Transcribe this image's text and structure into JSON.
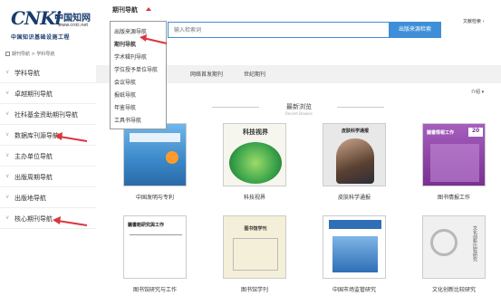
{
  "header": {
    "logo_cnki": "CNKi",
    "logo_cn_name": "中国知网",
    "logo_url": "www.cnki.net",
    "logo_project": "中国知识基础设施工程",
    "nav_title": "期刊导航",
    "search_placeholder": "输入检索词",
    "search_button": "出版来源检索",
    "help_link": "文献检索 ›"
  },
  "dropdown": {
    "items": [
      "出版来源导航",
      "期刊导航",
      "学术辑刊导航",
      "学位授予单位导航",
      "会议导航",
      "报纸导航",
      "年鉴导航",
      "工具书导航"
    ],
    "selected": "期刊导航"
  },
  "breadcrumb": {
    "home": "期刊导航",
    "sep": ">",
    "current": "学科导航"
  },
  "sidebar": {
    "items": [
      "学科导航",
      "卓越期刊导航",
      "社科基金资助期刊导航",
      "数据库刊源导航",
      "主办单位导航",
      "出版周期导航",
      "出版地导航",
      "核心期刊导航"
    ]
  },
  "tabs": [
    "网络首发期刊",
    "世纪期刊"
  ],
  "intro_button": "介绍 ▾",
  "recent": {
    "title": "最新浏览",
    "subtitle": "Recent Browse"
  },
  "journals": [
    {
      "title": "中国发明与专利",
      "color": "#4a9ad6",
      "icon": "blue-journal-cover"
    },
    {
      "title": "科技视界",
      "color": "#3aa34a",
      "icon": "green-leaf-cover"
    },
    {
      "title": "皮肤科学通报",
      "color": "#2d2d3a",
      "icon": "portrait-cover"
    },
    {
      "title": "图书情报工作",
      "color": "#8a3fa0",
      "icon": "purple-cover"
    },
    {
      "title": "图书馆研究与工作",
      "color": "#ffffff",
      "icon": "white-cover"
    },
    {
      "title": "图书馆学刊",
      "color": "#f4efd8",
      "icon": "cream-cover"
    },
    {
      "title": "中国市场监管研究",
      "color": "#2f6fb6",
      "icon": "blue-building-cover"
    },
    {
      "title": "文化创新比较研究",
      "color": "#e8e8e8",
      "icon": "grey-cover"
    }
  ],
  "colors": {
    "accent": "#3f8fd8",
    "arrow": "#d9363e",
    "logo": "#1a3c6d"
  }
}
